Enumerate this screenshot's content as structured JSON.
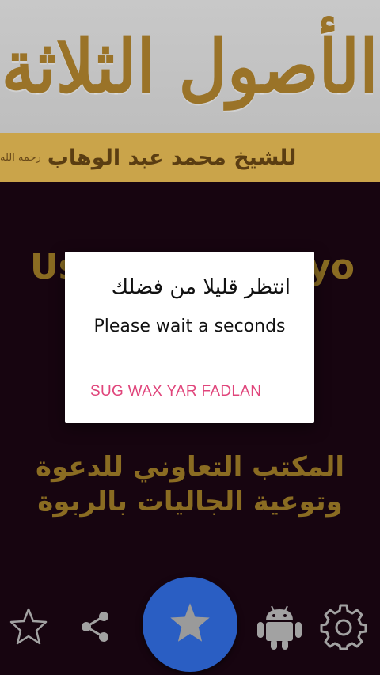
{
  "banner": {
    "title": "الأصول الثلاثة",
    "author": "للشيخ محمد عبد الوهاب",
    "author_note": "رحمه الله"
  },
  "background": {
    "left_fragment": "Us",
    "right_fragment": "yo",
    "office_line1": "المكتب التعاوني للدعوة",
    "office_line2": "وتوعية الجاليات بالربوة"
  },
  "dialog": {
    "title": "انتظر قليلا من فضلك",
    "message": "Please wait a seconds",
    "button_label": "SUG WAX YAR FADLAN"
  },
  "bottom_nav": {
    "icons": [
      "star-outline-icon",
      "share-icon",
      "star-icon",
      "android-icon",
      "settings-gear-icon"
    ],
    "fab_color": "#2a5ec3"
  },
  "colors": {
    "background": "#170510",
    "gold": "#8a6c22",
    "dialog_button": "#e0457b"
  }
}
